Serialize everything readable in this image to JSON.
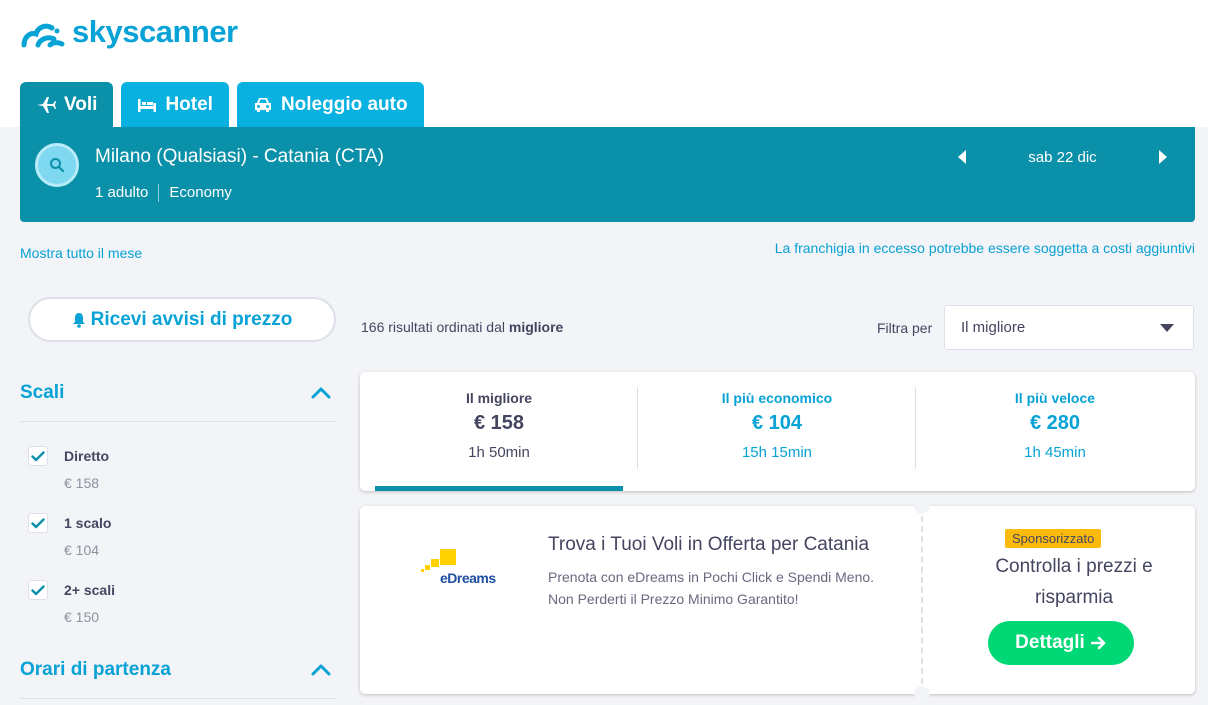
{
  "brand": {
    "name": "skyscanner",
    "color": "#07a2d6"
  },
  "tabs": [
    {
      "label": "Voli",
      "icon": "plane-icon",
      "active": true
    },
    {
      "label": "Hotel",
      "icon": "bed-icon",
      "active": false
    },
    {
      "label": "Noleggio auto",
      "icon": "car-icon",
      "active": false
    }
  ],
  "search": {
    "route": "Milano (Qualsiasi) - Catania (CTA)",
    "passengers": "1 adulto",
    "cabin": "Economy",
    "date": "sab 22 dic"
  },
  "links": {
    "month": "Mostra tutto il mese",
    "baggage": "La franchigia in eccesso potrebbe essere soggetta a costi aggiuntivi"
  },
  "alert_button": "Ricevi avvisi di prezzo",
  "filters": {
    "stops": {
      "title": "Scali",
      "items": [
        {
          "label": "Diretto",
          "price": "€ 158",
          "checked": true
        },
        {
          "label": "1 scalo",
          "price": "€ 104",
          "checked": true
        },
        {
          "label": "2+ scali",
          "price": "€ 150",
          "checked": true
        }
      ]
    },
    "departure_times": {
      "title": "Orari di partenza"
    }
  },
  "results": {
    "count_text": "166 risultati ordinati dal ",
    "count_bold": "migliore",
    "sort_label": "Filtra per",
    "sort_value": "Il migliore"
  },
  "summary": [
    {
      "label": "Il migliore",
      "price": "€ 158",
      "duration": "1h 50min",
      "active": true
    },
    {
      "label": "Il più economico",
      "price": "€ 104",
      "duration": "15h 15min",
      "active": false
    },
    {
      "label": "Il più veloce",
      "price": "€ 280",
      "duration": "1h 45min",
      "active": false
    }
  ],
  "ad": {
    "advertiser": "eDreams",
    "title": "Trova i Tuoi Voli in Offerta per Catania",
    "description": "Prenota con eDreams in Pochi Click e Spendi Meno. Non Perderti il Prezzo Minimo Garantito!",
    "badge": "Sponsorizzato",
    "right_text": "Controlla i prezzi e risparmia",
    "cta": "Dettagli"
  },
  "colors": {
    "teal_dark": "#0b90a9",
    "teal_tab": "#09b1e1",
    "link_blue": "#07a2d6",
    "cta_green": "#00d775",
    "sponsored_yellow": "#fcbb0c"
  }
}
